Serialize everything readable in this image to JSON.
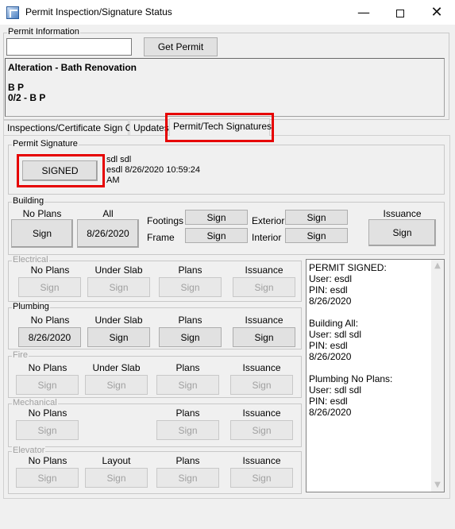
{
  "window": {
    "title": "Permit Inspection/Signature Status",
    "minimize": "—",
    "maximize": "",
    "close": "✕"
  },
  "permit_info": {
    "legend": "Permit Information",
    "input_value": "",
    "get_button": "Get Permit",
    "line1": "Alteration - Bath Renovation",
    "line2": "B P",
    "line3": "0/2 - B P"
  },
  "tabs": [
    {
      "label": "Inspections/Certificate Sign Off"
    },
    {
      "label": "Updates"
    },
    {
      "label": "Permit/Tech Signatures",
      "selected": true
    }
  ],
  "permit_signature": {
    "legend": "Permit Signature",
    "button": "SIGNED",
    "line1": "sdl sdl",
    "line2": "esdl 8/26/2020 10:59:24",
    "line3": "AM"
  },
  "building": {
    "legend": "Building",
    "no_plans_label": "No Plans",
    "no_plans_button": "Sign",
    "all_label": "All",
    "all_button": "8/26/2020",
    "footings_label": "Footings",
    "footings_button": "Sign",
    "frame_label": "Frame",
    "frame_button": "Sign",
    "exterior_label": "Exterior",
    "exterior_button": "Sign",
    "interior_label": "Interior",
    "interior_button": "Sign",
    "issuance_label": "Issuance",
    "issuance_button": "Sign"
  },
  "electrical": {
    "legend": "Electrical",
    "c1": "No Plans",
    "b1": "Sign",
    "c2": "Under Slab",
    "b2": "Sign",
    "c3": "Plans",
    "b3": "Sign",
    "c4": "Issuance",
    "b4": "Sign"
  },
  "plumbing": {
    "legend": "Plumbing",
    "c1": "No Plans",
    "b1": "8/26/2020",
    "c2": "Under Slab",
    "b2": "Sign",
    "c3": "Plans",
    "b3": "Sign",
    "c4": "Issuance",
    "b4": "Sign"
  },
  "fire": {
    "legend": "Fire",
    "c1": "No Plans",
    "b1": "Sign",
    "c2": "Under Slab",
    "b2": "Sign",
    "c3": "Plans",
    "b3": "Sign",
    "c4": "Issuance",
    "b4": "Sign"
  },
  "mechanical": {
    "legend": "Mechanical",
    "c1": "No Plans",
    "b1": "Sign",
    "c3": "Plans",
    "b3": "Sign",
    "c4": "Issuance",
    "b4": "Sign"
  },
  "elevator": {
    "legend": "Elevator",
    "c1": "No Plans",
    "b1": "Sign",
    "c2": "Layout",
    "b2": "Sign",
    "c3": "Plans",
    "b3": "Sign",
    "c4": "Issuance",
    "b4": "Sign"
  },
  "log": {
    "text": "PERMIT SIGNED:\nUser: esdl\nPIN: esdl\n8/26/2020\n\nBuilding All:\nUser: sdl sdl\nPIN: esdl\n8/26/2020\n\nPlumbing No Plans:\nUser: sdl sdl\nPIN: esdl\n8/26/2020"
  },
  "colors": {
    "highlight": "#e60000",
    "disabled_text": "#a0a0a0"
  }
}
